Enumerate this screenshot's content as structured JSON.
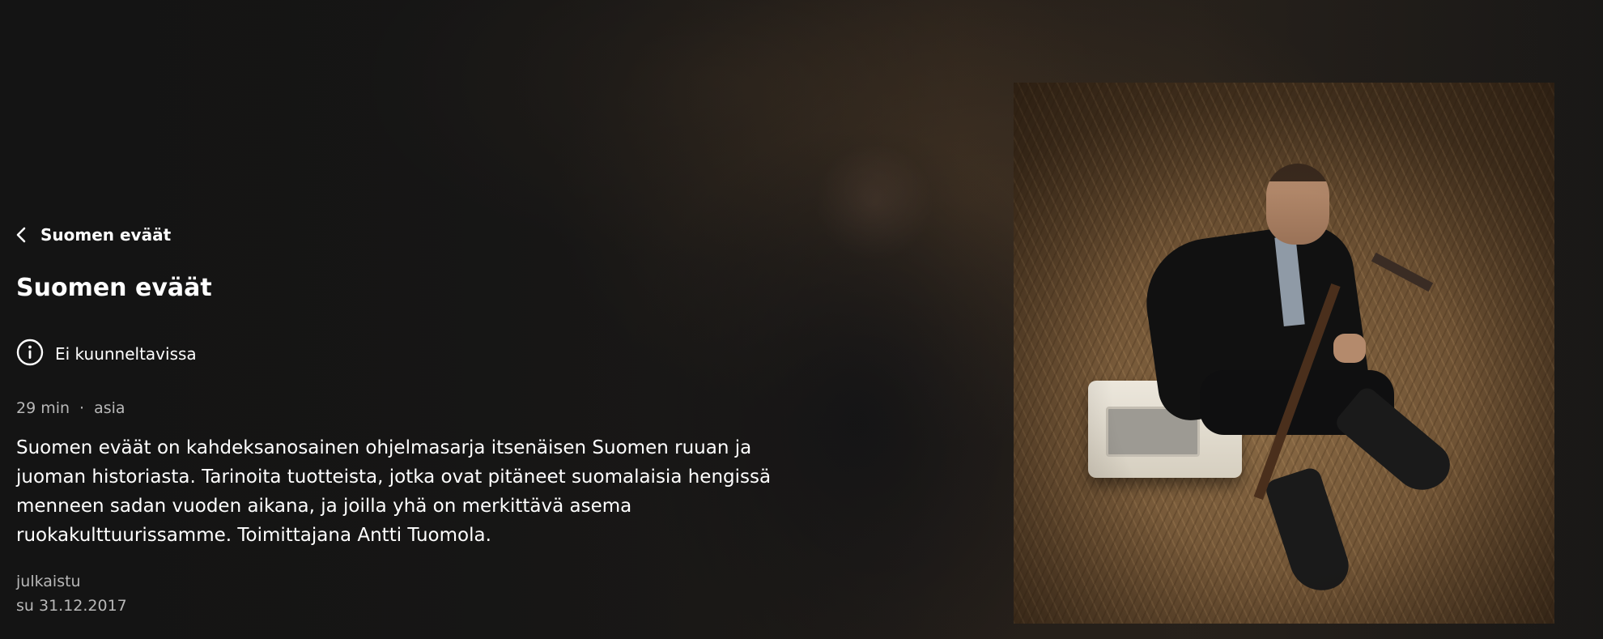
{
  "breadcrumb": {
    "back_label": "Suomen eväät"
  },
  "header": {
    "title": "Suomen eväät"
  },
  "availability": {
    "label": "Ei kuunneltavissa",
    "icon": "info-icon"
  },
  "meta": {
    "duration": "29 min",
    "separator": "·",
    "category": "asia"
  },
  "description": "Suomen eväät on kahdeksanosainen ohjelmasarja itsenäisen Suomen ruuan ja juoman historiasta. Tarinoita tuotteista, jotka ovat pitäneet suomalaisia hengissä menneen sadan vuoden aikana, ja joilla yhä on merkittävä asema ruokakulttuurissamme. Toimittajana Antti Tuomola.",
  "published": {
    "label": "julkaistu",
    "date": "su 31.12.2017"
  },
  "colors": {
    "background": "#151515",
    "text": "#ffffff",
    "muted_text": "#b8b8b8"
  }
}
